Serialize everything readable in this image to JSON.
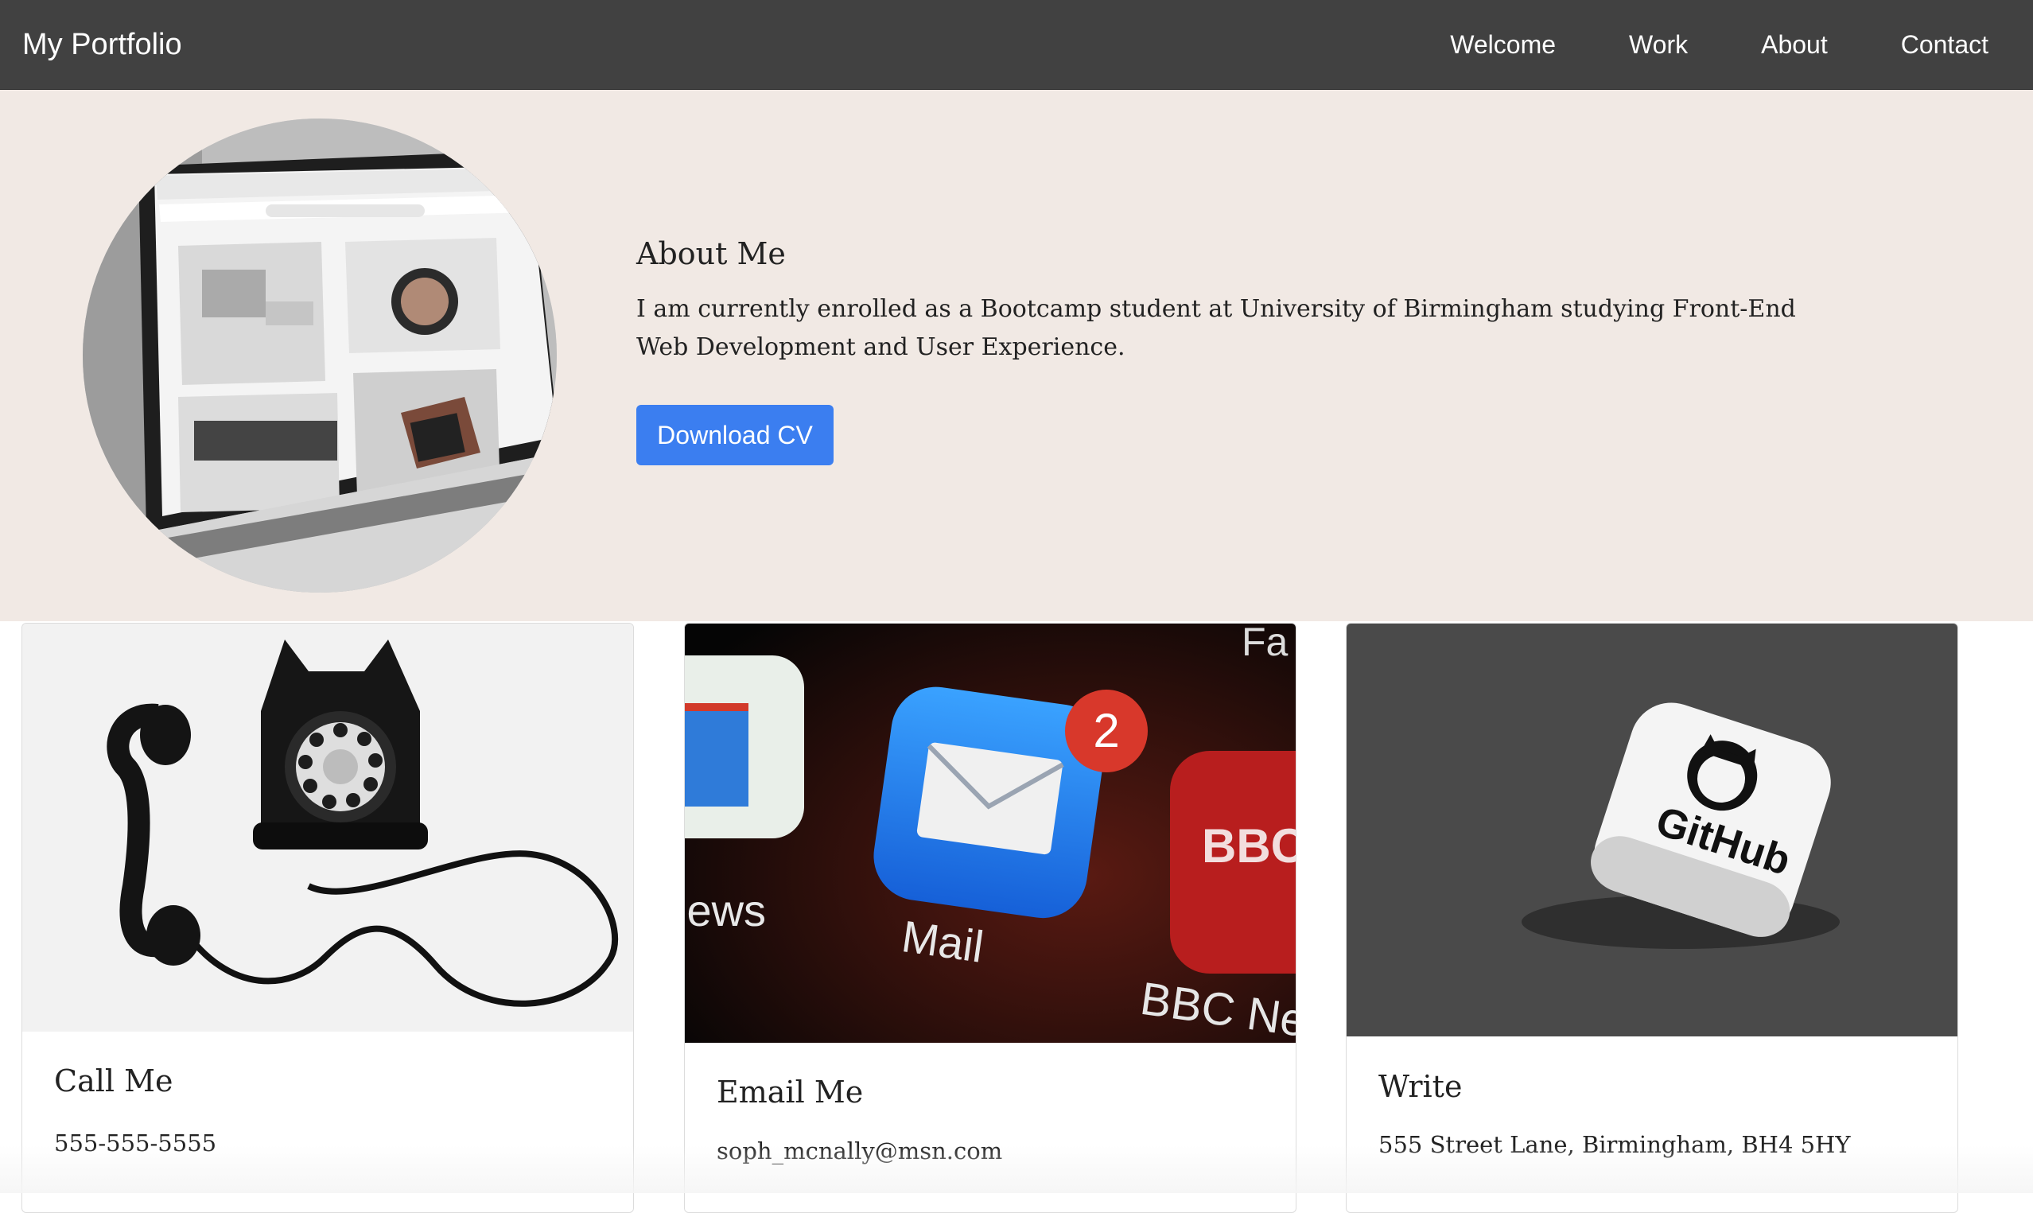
{
  "navbar": {
    "brand": "My Portfolio",
    "links": [
      "Welcome",
      "Work",
      "About",
      "Contact"
    ]
  },
  "about": {
    "heading": "About Me",
    "body": "I am currently enrolled as a Bootcamp student at University of Birmingham studying Front-End Web Development and User Experience.",
    "button_label": "Download CV"
  },
  "cards": [
    {
      "title": "Call Me",
      "text": "555-555-5555",
      "image_icon": "rotary-phone-icon"
    },
    {
      "title": "Email Me",
      "text": "soph_mcnally@msn.com",
      "image_icon": "mail-app-icon"
    },
    {
      "title": "Write",
      "text": "555 Street Lane, Birmingham, BH4 5HY",
      "image_icon": "github-logo-icon"
    }
  ],
  "photo_labels": {
    "mail_app": "Mail",
    "mail_badge": "2",
    "news_partial": "lews",
    "bbc_partial": "BBC Ne",
    "bbc_tile": "BBC NEW",
    "fa_partial": "Fa",
    "github": "GitHub"
  },
  "colors": {
    "navbar_bg": "#414141",
    "about_bg": "#f1e9e4",
    "button_bg": "#3b7ef0"
  }
}
